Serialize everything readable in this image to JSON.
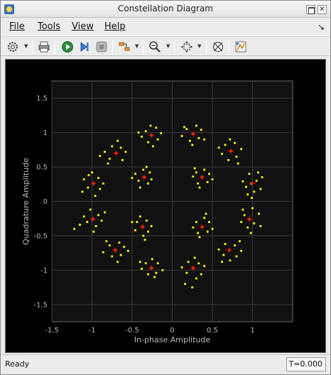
{
  "window": {
    "title": "Constellation Diagram"
  },
  "menu": {
    "file": "File",
    "tools": "Tools",
    "view": "View",
    "help": "Help"
  },
  "statusbar": {
    "status": "Ready",
    "time": "T=0.000"
  },
  "colors": {
    "received": "#ffff00",
    "reference": "#ff0000",
    "background": "#000000",
    "axes": "#111111"
  },
  "chart_data": {
    "type": "scatter",
    "xlabel": "In-phase Amplitude",
    "ylabel": "Quadrature Amplitude",
    "xlim": [
      -1.5,
      1.5
    ],
    "ylim": [
      -1.75,
      1.75
    ],
    "x_ticks": [
      -1.5,
      -1,
      -0.5,
      0,
      0.5,
      1
    ],
    "x_tick_labels": [
      "-1.5",
      "-1",
      "-0.5",
      "0",
      "0.5",
      "1"
    ],
    "y_ticks": [
      -1.5,
      -1,
      -0.5,
      0,
      0.5,
      1,
      1.5
    ],
    "y_tick_labels": [
      "-1.5",
      "-1",
      "-0.5",
      "0",
      "0.5",
      "1",
      "1.5"
    ],
    "grid": true,
    "reference_points": [
      {
        "x": 1.0,
        "y": 0.26
      },
      {
        "x": 0.73,
        "y": 0.73
      },
      {
        "x": 0.26,
        "y": 0.98
      },
      {
        "x": -0.26,
        "y": 0.96
      },
      {
        "x": -0.7,
        "y": 0.7
      },
      {
        "x": -0.98,
        "y": 0.26
      },
      {
        "x": -0.99,
        "y": -0.26
      },
      {
        "x": -0.71,
        "y": -0.71
      },
      {
        "x": -0.26,
        "y": -0.97
      },
      {
        "x": 0.26,
        "y": -0.97
      },
      {
        "x": 0.71,
        "y": -0.71
      },
      {
        "x": 0.96,
        "y": -0.26
      },
      {
        "x": 0.37,
        "y": 0.35
      },
      {
        "x": -0.35,
        "y": 0.35
      },
      {
        "x": -0.37,
        "y": -0.37
      },
      {
        "x": 0.37,
        "y": -0.37
      }
    ],
    "received_points": [
      [
        0.98,
        0.26
      ],
      [
        1.05,
        0.3
      ],
      [
        0.92,
        0.21
      ],
      [
        1.1,
        0.18
      ],
      [
        0.96,
        0.4
      ],
      [
        0.88,
        0.29
      ],
      [
        1.02,
        0.14
      ],
      [
        1.12,
        0.35
      ],
      [
        0.94,
        0.1
      ],
      [
        1.07,
        0.42
      ],
      [
        0.99,
        0.05
      ],
      [
        0.73,
        0.73
      ],
      [
        0.66,
        0.82
      ],
      [
        0.8,
        0.65
      ],
      [
        0.7,
        0.6
      ],
      [
        0.78,
        0.85
      ],
      [
        0.62,
        0.69
      ],
      [
        0.86,
        0.76
      ],
      [
        0.72,
        0.9
      ],
      [
        0.58,
        0.78
      ],
      [
        0.82,
        0.55
      ],
      [
        0.26,
        0.98
      ],
      [
        0.18,
        1.05
      ],
      [
        0.33,
        0.92
      ],
      [
        0.22,
        0.88
      ],
      [
        0.36,
        1.04
      ],
      [
        0.12,
        0.95
      ],
      [
        0.3,
        1.1
      ],
      [
        0.4,
        0.9
      ],
      [
        0.15,
        1.08
      ],
      [
        0.25,
        0.82
      ],
      [
        -0.26,
        0.96
      ],
      [
        -0.33,
        1.02
      ],
      [
        -0.18,
        0.9
      ],
      [
        -0.3,
        0.86
      ],
      [
        -0.2,
        1.07
      ],
      [
        -0.38,
        0.94
      ],
      [
        -0.14,
        0.99
      ],
      [
        -0.27,
        1.1
      ],
      [
        -0.42,
        1.0
      ],
      [
        -0.24,
        0.8
      ],
      [
        -0.7,
        0.7
      ],
      [
        -0.78,
        0.62
      ],
      [
        -0.64,
        0.78
      ],
      [
        -0.75,
        0.8
      ],
      [
        -0.62,
        0.6
      ],
      [
        -0.84,
        0.72
      ],
      [
        -0.68,
        0.88
      ],
      [
        -0.58,
        0.72
      ],
      [
        -0.8,
        0.55
      ],
      [
        -0.9,
        0.66
      ],
      [
        -0.98,
        0.26
      ],
      [
        -1.05,
        0.2
      ],
      [
        -0.92,
        0.34
      ],
      [
        -0.9,
        0.18
      ],
      [
        -1.1,
        0.32
      ],
      [
        -1.0,
        0.42
      ],
      [
        -0.86,
        0.26
      ],
      [
        -1.12,
        0.14
      ],
      [
        -0.96,
        0.08
      ],
      [
        -1.04,
        0.38
      ],
      [
        -0.99,
        -0.26
      ],
      [
        -1.06,
        -0.3
      ],
      [
        -0.92,
        -0.2
      ],
      [
        -0.95,
        -0.36
      ],
      [
        -1.1,
        -0.22
      ],
      [
        -0.88,
        -0.28
      ],
      [
        -1.02,
        -0.12
      ],
      [
        -1.15,
        -0.34
      ],
      [
        -0.98,
        -0.44
      ],
      [
        -0.84,
        -0.16
      ],
      [
        -1.22,
        -0.4
      ],
      [
        -0.71,
        -0.71
      ],
      [
        -0.78,
        -0.64
      ],
      [
        -0.64,
        -0.78
      ],
      [
        -0.75,
        -0.8
      ],
      [
        -0.6,
        -0.66
      ],
      [
        -0.86,
        -0.74
      ],
      [
        -0.68,
        -0.88
      ],
      [
        -0.55,
        -0.72
      ],
      [
        -0.82,
        -0.58
      ],
      [
        -0.66,
        -0.6
      ],
      [
        -0.26,
        -0.97
      ],
      [
        -0.33,
        -0.9
      ],
      [
        -0.2,
        -1.04
      ],
      [
        -0.3,
        -1.06
      ],
      [
        -0.18,
        -0.9
      ],
      [
        -0.38,
        -0.98
      ],
      [
        -0.12,
        -1.0
      ],
      [
        -0.25,
        -0.84
      ],
      [
        -0.4,
        -0.88
      ],
      [
        -0.22,
        -1.1
      ],
      [
        0.26,
        -0.97
      ],
      [
        0.18,
        -1.04
      ],
      [
        0.33,
        -0.9
      ],
      [
        0.2,
        -0.88
      ],
      [
        0.36,
        -1.06
      ],
      [
        0.12,
        -0.96
      ],
      [
        0.3,
        -1.12
      ],
      [
        0.4,
        -0.94
      ],
      [
        0.16,
        -1.2
      ],
      [
        0.25,
        -1.25
      ],
      [
        0.28,
        -0.82
      ],
      [
        0.71,
        -0.71
      ],
      [
        0.64,
        -0.78
      ],
      [
        0.78,
        -0.64
      ],
      [
        0.66,
        -0.62
      ],
      [
        0.8,
        -0.8
      ],
      [
        0.58,
        -0.7
      ],
      [
        0.86,
        -0.72
      ],
      [
        0.72,
        -0.86
      ],
      [
        0.62,
        -0.88
      ],
      [
        0.84,
        -0.58
      ],
      [
        0.96,
        -0.26
      ],
      [
        1.02,
        -0.32
      ],
      [
        0.9,
        -0.2
      ],
      [
        1.08,
        -0.18
      ],
      [
        0.94,
        -0.38
      ],
      [
        0.86,
        -0.3
      ],
      [
        1.0,
        -0.1
      ],
      [
        1.1,
        -0.36
      ],
      [
        0.98,
        -0.46
      ],
      [
        0.88,
        -0.12
      ],
      [
        0.37,
        0.35
      ],
      [
        0.3,
        0.42
      ],
      [
        0.44,
        0.28
      ],
      [
        0.32,
        0.26
      ],
      [
        0.46,
        0.4
      ],
      [
        0.26,
        0.36
      ],
      [
        0.4,
        0.46
      ],
      [
        0.34,
        0.2
      ],
      [
        0.5,
        0.32
      ],
      [
        0.28,
        0.48
      ],
      [
        -0.35,
        0.35
      ],
      [
        -0.42,
        0.3
      ],
      [
        -0.28,
        0.42
      ],
      [
        -0.3,
        0.26
      ],
      [
        -0.46,
        0.4
      ],
      [
        -0.36,
        0.46
      ],
      [
        -0.26,
        0.32
      ],
      [
        -0.5,
        0.34
      ],
      [
        -0.4,
        0.2
      ],
      [
        -0.32,
        0.5
      ],
      [
        -0.37,
        -0.37
      ],
      [
        -0.44,
        -0.3
      ],
      [
        -0.3,
        -0.44
      ],
      [
        -0.32,
        -0.28
      ],
      [
        -0.46,
        -0.42
      ],
      [
        -0.36,
        -0.5
      ],
      [
        -0.26,
        -0.36
      ],
      [
        -0.5,
        -0.3
      ],
      [
        -0.4,
        -0.22
      ],
      [
        -0.34,
        -0.56
      ],
      [
        0.37,
        -0.37
      ],
      [
        0.3,
        -0.3
      ],
      [
        0.44,
        -0.44
      ],
      [
        0.32,
        -0.46
      ],
      [
        0.46,
        -0.3
      ],
      [
        0.26,
        -0.38
      ],
      [
        0.4,
        -0.24
      ],
      [
        0.5,
        -0.4
      ],
      [
        0.34,
        -0.52
      ],
      [
        0.42,
        -0.18
      ]
    ]
  }
}
